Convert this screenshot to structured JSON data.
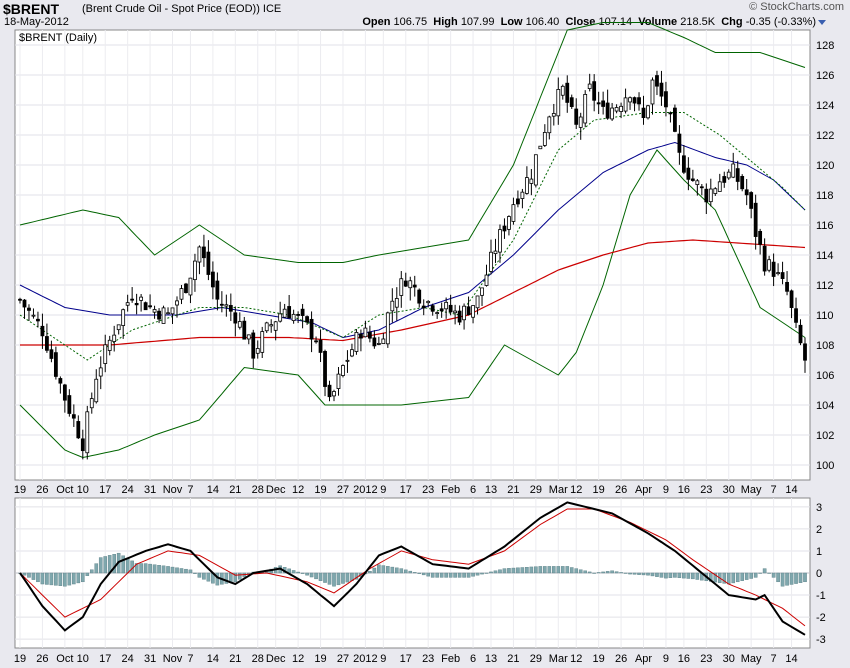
{
  "header": {
    "symbol": "$BRENT",
    "description": "(Brent Crude Oil - Spot Price (EOD)) ICE",
    "date": "18-May-2012",
    "brand": "© StockCharts.com",
    "open_label": "Open",
    "open": "106.75",
    "high_label": "High",
    "high": "107.99",
    "low_label": "Low",
    "low": "106.40",
    "close_label": "Close",
    "close": "107.14",
    "volume_label": "Volume",
    "volume": "218.5K",
    "chg_label": "Chg",
    "chg": "-0.35 (-0.33%)"
  },
  "colors": {
    "background": "#e9e9ef",
    "up": "#ffffff",
    "down": "#000000",
    "bb": "#006400",
    "sma50": "#00008b",
    "sma200": "#cc0000",
    "histogram": "#7fa7ad",
    "signal": "#cc0000"
  },
  "chart_data": [
    {
      "type": "candlestick",
      "panel_label": "$BRENT (Daily)",
      "ylim": [
        99,
        129
      ],
      "y_ticks": [
        100,
        102,
        104,
        106,
        108,
        110,
        112,
        114,
        116,
        118,
        120,
        122,
        124,
        126,
        128
      ],
      "x_tick_labels": [
        "19",
        "26",
        "Oct",
        "10",
        "17",
        "24",
        "31",
        "Nov",
        "7",
        "14",
        "21",
        "28",
        "Dec",
        "12",
        "19",
        "27",
        "2012",
        "9",
        "17",
        "23",
        "Feb",
        "6",
        "13",
        "21",
        "29",
        "Mar",
        "12",
        "19",
        "26",
        "Apr",
        "9",
        "16",
        "23",
        "30",
        "May",
        "7",
        "14"
      ],
      "close_anchors": [
        [
          0,
          111.0
        ],
        [
          5,
          109.0
        ],
        [
          10,
          104.5
        ],
        [
          14,
          101.5
        ],
        [
          17,
          106.0
        ],
        [
          21,
          109.0
        ],
        [
          25,
          111.5
        ],
        [
          29,
          110.5
        ],
        [
          33,
          110.0
        ],
        [
          37,
          112.0
        ],
        [
          40,
          114.5
        ],
        [
          44,
          111.0
        ],
        [
          48,
          110.0
        ],
        [
          52,
          107.5
        ],
        [
          55,
          109.0
        ],
        [
          59,
          110.5
        ],
        [
          63,
          109.5
        ],
        [
          66,
          108.5
        ],
        [
          69,
          104.0
        ],
        [
          72,
          106.5
        ],
        [
          76,
          109.0
        ],
        [
          80,
          108.0
        ],
        [
          83,
          111.0
        ],
        [
          86,
          112.5
        ],
        [
          90,
          111.0
        ],
        [
          94,
          110.5
        ],
        [
          98,
          110.0
        ],
        [
          102,
          111.0
        ],
        [
          106,
          114.5
        ],
        [
          110,
          117.5
        ],
        [
          114,
          119.5
        ],
        [
          118,
          123.5
        ],
        [
          121,
          125.0
        ],
        [
          124,
          122.5
        ],
        [
          127,
          125.0
        ],
        [
          130,
          123.5
        ],
        [
          133,
          124.0
        ],
        [
          136,
          125.0
        ],
        [
          139,
          123.0
        ],
        [
          141,
          125.5
        ],
        [
          144,
          124.0
        ],
        [
          147,
          120.5
        ],
        [
          150,
          119.0
        ],
        [
          153,
          118.0
        ],
        [
          156,
          119.0
        ],
        [
          159,
          119.5
        ],
        [
          162,
          118.0
        ],
        [
          164,
          115.5
        ],
        [
          166,
          113.5
        ],
        [
          168,
          113.0
        ],
        [
          171,
          111.5
        ],
        [
          173,
          109.0
        ],
        [
          175,
          107.0
        ]
      ],
      "series": [
        {
          "name": "Bollinger Bands (20,2)",
          "upper_anchors": [
            [
              0,
              116.0
            ],
            [
              14,
              117.0
            ],
            [
              22,
              116.5
            ],
            [
              30,
              114.0
            ],
            [
              40,
              116.0
            ],
            [
              50,
              114.0
            ],
            [
              62,
              113.5
            ],
            [
              72,
              113.5
            ],
            [
              80,
              114.0
            ],
            [
              90,
              114.5
            ],
            [
              100,
              115.0
            ],
            [
              110,
              120.0
            ],
            [
              118,
              126.0
            ],
            [
              122,
              129.0
            ],
            [
              130,
              129.5
            ],
            [
              140,
              129.5
            ],
            [
              148,
              128.5
            ],
            [
              155,
              127.5
            ],
            [
              165,
              127.5
            ],
            [
              175,
              126.5
            ]
          ],
          "lower_anchors": [
            [
              0,
              104.0
            ],
            [
              10,
              101.0
            ],
            [
              14,
              100.5
            ],
            [
              22,
              101.0
            ],
            [
              30,
              102.0
            ],
            [
              40,
              103.0
            ],
            [
              50,
              106.5
            ],
            [
              62,
              106.0
            ],
            [
              68,
              104.0
            ],
            [
              75,
              104.0
            ],
            [
              85,
              104.0
            ],
            [
              100,
              104.5
            ],
            [
              108,
              108.0
            ],
            [
              114,
              107.0
            ],
            [
              120,
              106.0
            ],
            [
              124,
              107.5
            ],
            [
              130,
              112.0
            ],
            [
              136,
              118.0
            ],
            [
              142,
              121.0
            ],
            [
              148,
              119.0
            ],
            [
              155,
              117.0
            ],
            [
              165,
              110.5
            ],
            [
              175,
              108.5
            ]
          ]
        },
        {
          "name": "SMA 20",
          "anchors": [
            [
              0,
              110.0
            ],
            [
              15,
              107.0
            ],
            [
              25,
              109.0
            ],
            [
              40,
              110.5
            ],
            [
              50,
              110.5
            ],
            [
              60,
              110.0
            ],
            [
              72,
              108.5
            ],
            [
              80,
              110.0
            ],
            [
              90,
              110.5
            ],
            [
              98,
              110.0
            ],
            [
              110,
              115.0
            ],
            [
              120,
              121.0
            ],
            [
              128,
              123.0
            ],
            [
              140,
              123.5
            ],
            [
              148,
              123.5
            ],
            [
              156,
              122.0
            ],
            [
              164,
              120.0
            ],
            [
              170,
              118.5
            ],
            [
              175,
              117.0
            ]
          ]
        },
        {
          "name": "SMA 50",
          "anchors": [
            [
              0,
              112.0
            ],
            [
              10,
              110.5
            ],
            [
              20,
              110.0
            ],
            [
              35,
              110.0
            ],
            [
              45,
              110.5
            ],
            [
              55,
              110.0
            ],
            [
              65,
              109.5
            ],
            [
              72,
              108.5
            ],
            [
              80,
              109.0
            ],
            [
              90,
              110.5
            ],
            [
              100,
              111.5
            ],
            [
              110,
              114.0
            ],
            [
              120,
              117.0
            ],
            [
              130,
              119.5
            ],
            [
              140,
              121.0
            ],
            [
              146,
              121.5
            ],
            [
              155,
              120.5
            ],
            [
              162,
              120.0
            ],
            [
              168,
              119.0
            ],
            [
              175,
              117.0
            ]
          ]
        },
        {
          "name": "SMA 200",
          "anchors": [
            [
              0,
              108.0
            ],
            [
              20,
              108.0
            ],
            [
              40,
              108.5
            ],
            [
              60,
              108.5
            ],
            [
              72,
              108.3
            ],
            [
              85,
              109.0
            ],
            [
              100,
              110.0
            ],
            [
              110,
              111.5
            ],
            [
              120,
              113.0
            ],
            [
              130,
              114.0
            ],
            [
              140,
              114.8
            ],
            [
              150,
              115.0
            ],
            [
              160,
              114.8
            ],
            [
              175,
              114.5
            ]
          ]
        }
      ]
    },
    {
      "type": "line",
      "panel_label": "MACD",
      "ylim": [
        -3.4,
        3.4
      ],
      "y_ticks": [
        3,
        2,
        1,
        0,
        -1,
        -2,
        -3
      ],
      "series": [
        {
          "name": "MACD",
          "anchors": [
            [
              0,
              0.0
            ],
            [
              5,
              -1.5
            ],
            [
              10,
              -2.6
            ],
            [
              14,
              -2.0
            ],
            [
              18,
              -0.5
            ],
            [
              22,
              0.5
            ],
            [
              28,
              1.0
            ],
            [
              33,
              1.3
            ],
            [
              38,
              1.0
            ],
            [
              44,
              -0.2
            ],
            [
              48,
              -0.5
            ],
            [
              52,
              0.0
            ],
            [
              58,
              0.2
            ],
            [
              64,
              -0.5
            ],
            [
              70,
              -1.5
            ],
            [
              75,
              -0.5
            ],
            [
              80,
              0.8
            ],
            [
              85,
              1.2
            ],
            [
              92,
              0.4
            ],
            [
              100,
              0.2
            ],
            [
              108,
              1.2
            ],
            [
              116,
              2.5
            ],
            [
              122,
              3.2
            ],
            [
              126,
              3.0
            ],
            [
              132,
              2.7
            ],
            [
              140,
              1.8
            ],
            [
              146,
              1.0
            ],
            [
              152,
              0.0
            ],
            [
              158,
              -1.0
            ],
            [
              164,
              -1.2
            ],
            [
              166,
              -1.0
            ],
            [
              170,
              -2.2
            ],
            [
              175,
              -2.8
            ]
          ]
        },
        {
          "name": "Signal",
          "anchors": [
            [
              0,
              0.0
            ],
            [
              10,
              -2.0
            ],
            [
              18,
              -1.2
            ],
            [
              26,
              0.4
            ],
            [
              33,
              1.0
            ],
            [
              40,
              0.8
            ],
            [
              48,
              -0.1
            ],
            [
              55,
              0.0
            ],
            [
              64,
              -0.4
            ],
            [
              70,
              -0.9
            ],
            [
              78,
              0.2
            ],
            [
              85,
              1.0
            ],
            [
              92,
              0.6
            ],
            [
              100,
              0.4
            ],
            [
              108,
              1.0
            ],
            [
              116,
              2.2
            ],
            [
              122,
              2.9
            ],
            [
              128,
              2.9
            ],
            [
              136,
              2.3
            ],
            [
              144,
              1.5
            ],
            [
              150,
              0.6
            ],
            [
              158,
              -0.5
            ],
            [
              164,
              -1.0
            ],
            [
              170,
              -1.6
            ],
            [
              175,
              -2.4
            ]
          ]
        }
      ]
    }
  ]
}
